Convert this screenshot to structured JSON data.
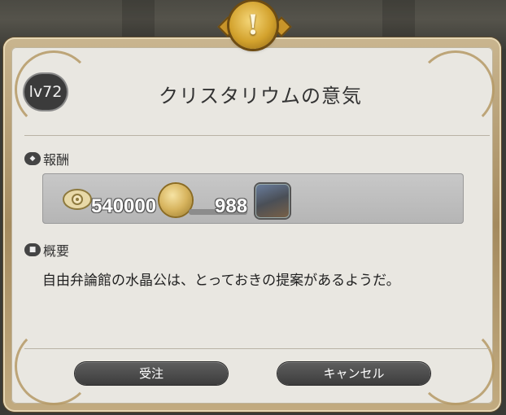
{
  "quest": {
    "level": "lv72",
    "title": "クリスタリウムの意気"
  },
  "rewards": {
    "heading": "報酬",
    "gil": "540000",
    "coin_count": "988"
  },
  "summary": {
    "heading": "概要",
    "text": "自由弁論館の水晶公は、とっておきの提案があるようだ。"
  },
  "buttons": {
    "accept": "受注",
    "cancel": "キャンセル"
  },
  "icons": {
    "emblem": "exclamation-emblem-icon",
    "rewards": "rewards-section-icon",
    "summary": "summary-section-icon",
    "gil": "gil-icon",
    "coin": "coin-icon",
    "item": "item-icon"
  },
  "colors": {
    "panel": "#e9e7e1",
    "frame": "#b69a66",
    "button": "#4a4a4a"
  }
}
